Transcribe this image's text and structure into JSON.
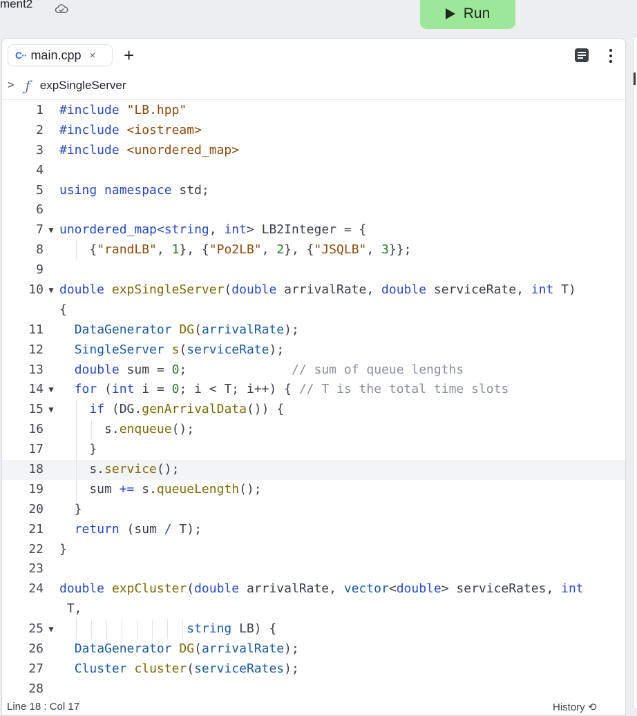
{
  "topbar": {
    "project_name": "ment2",
    "run_label": "Run"
  },
  "tabs": [
    {
      "label": "main.cpp",
      "icon": "cpp-icon",
      "close": "×"
    }
  ],
  "breadcrumb": {
    "func_symbol": "ƒ",
    "name": "expSingleServer"
  },
  "editor": {
    "lines": [
      {
        "n": "1",
        "fold": "",
        "guides": [],
        "t": [
          [
            "k",
            "#include "
          ],
          [
            "s",
            "\"LB.hpp\""
          ]
        ]
      },
      {
        "n": "2",
        "fold": "",
        "guides": [],
        "t": [
          [
            "k",
            "#include "
          ],
          [
            "s",
            "<iostream>"
          ]
        ]
      },
      {
        "n": "3",
        "fold": "",
        "guides": [],
        "t": [
          [
            "k",
            "#include "
          ],
          [
            "s",
            "<unordered_map>"
          ]
        ]
      },
      {
        "n": "4",
        "fold": "",
        "guides": [],
        "t": []
      },
      {
        "n": "5",
        "fold": "",
        "guides": [],
        "t": [
          [
            "k",
            "using namespace"
          ],
          [
            "p",
            " std;"
          ]
        ]
      },
      {
        "n": "6",
        "fold": "",
        "guides": [],
        "t": []
      },
      {
        "n": "7",
        "fold": "▼",
        "guides": [],
        "t": [
          [
            "k",
            "unordered_map<string"
          ],
          [
            "p",
            ", "
          ],
          [
            "k",
            "int"
          ],
          [
            "p",
            "> LB2Integer = {"
          ]
        ]
      },
      {
        "n": "8",
        "fold": "",
        "guides": [
          24
        ],
        "t": [
          [
            "p",
            "    {"
          ],
          [
            "s",
            "\"randLB\""
          ],
          [
            "p",
            ", "
          ],
          [
            "n",
            "1"
          ],
          [
            "p",
            "}, {"
          ],
          [
            "s",
            "\"Po2LB\""
          ],
          [
            "p",
            ", "
          ],
          [
            "n",
            "2"
          ],
          [
            "p",
            "}, {"
          ],
          [
            "s",
            "\"JSQLB\""
          ],
          [
            "p",
            ", "
          ],
          [
            "n",
            "3"
          ],
          [
            "p",
            "}};"
          ]
        ]
      },
      {
        "n": "9",
        "fold": "",
        "guides": [],
        "t": []
      },
      {
        "n": "10",
        "fold": "▼",
        "guides": [],
        "t": [
          [
            "k",
            "double "
          ],
          [
            "f",
            "expSingleServer"
          ],
          [
            "p",
            "("
          ],
          [
            "k",
            "double "
          ],
          [
            "p",
            "arrivalRate, "
          ],
          [
            "k",
            "double "
          ],
          [
            "p",
            "serviceRate, "
          ],
          [
            "k",
            "int "
          ],
          [
            "p",
            "T)"
          ]
        ]
      },
      {
        "n": "",
        "fold": "",
        "guides": [],
        "t": [
          [
            "p",
            "{"
          ]
        ]
      },
      {
        "n": "11",
        "fold": "",
        "guides": [],
        "t": [
          [
            "p",
            "  "
          ],
          [
            "v",
            "DataGenerator "
          ],
          [
            "f",
            "DG"
          ],
          [
            "p",
            "("
          ],
          [
            "v",
            "arrivalRate"
          ],
          [
            "p",
            ");"
          ]
        ]
      },
      {
        "n": "12",
        "fold": "",
        "guides": [],
        "t": [
          [
            "p",
            "  "
          ],
          [
            "v",
            "SingleServer "
          ],
          [
            "f",
            "s"
          ],
          [
            "p",
            "("
          ],
          [
            "v",
            "serviceRate"
          ],
          [
            "p",
            ");"
          ]
        ]
      },
      {
        "n": "13",
        "fold": "",
        "guides": [],
        "t": [
          [
            "p",
            "  "
          ],
          [
            "k",
            "double "
          ],
          [
            "p",
            "sum = "
          ],
          [
            "n",
            "0"
          ],
          [
            "p",
            ";              "
          ],
          [
            "c",
            "// sum of queue lengths"
          ]
        ]
      },
      {
        "n": "14",
        "fold": "▼",
        "guides": [],
        "t": [
          [
            "p",
            "  "
          ],
          [
            "k",
            "for "
          ],
          [
            "p",
            "("
          ],
          [
            "k",
            "int "
          ],
          [
            "p",
            "i = "
          ],
          [
            "n",
            "0"
          ],
          [
            "p",
            "; i < T; i++) { "
          ],
          [
            "c",
            "// T is the total time slots"
          ]
        ]
      },
      {
        "n": "15",
        "fold": "▼",
        "guides": [
          24
        ],
        "t": [
          [
            "p",
            "    "
          ],
          [
            "k",
            "if "
          ],
          [
            "p",
            "(DG."
          ],
          [
            "f",
            "genArrivalData"
          ],
          [
            "p",
            "()) {"
          ]
        ]
      },
      {
        "n": "16",
        "fold": "",
        "guides": [
          24,
          46
        ],
        "t": [
          [
            "p",
            "      s."
          ],
          [
            "f",
            "enqueue"
          ],
          [
            "p",
            "();"
          ]
        ]
      },
      {
        "n": "17",
        "fold": "",
        "guides": [
          24
        ],
        "t": [
          [
            "p",
            "    }"
          ]
        ]
      },
      {
        "n": "18",
        "fold": "",
        "guides": [
          24
        ],
        "active": true,
        "t": [
          [
            "p",
            "    s."
          ],
          [
            "f",
            "service"
          ],
          [
            "p",
            "();"
          ]
        ]
      },
      {
        "n": "19",
        "fold": "",
        "guides": [
          24
        ],
        "t": [
          [
            "p",
            "    sum "
          ],
          [
            "k",
            "+="
          ],
          [
            "p",
            " s."
          ],
          [
            "f",
            "queueLength"
          ],
          [
            "p",
            "();"
          ]
        ]
      },
      {
        "n": "20",
        "fold": "",
        "guides": [],
        "t": [
          [
            "p",
            "  }"
          ]
        ]
      },
      {
        "n": "21",
        "fold": "",
        "guides": [],
        "t": [
          [
            "p",
            "  "
          ],
          [
            "k",
            "return "
          ],
          [
            "p",
            "(sum "
          ],
          [
            "k",
            "/"
          ],
          [
            "p",
            " T);"
          ]
        ]
      },
      {
        "n": "22",
        "fold": "",
        "guides": [],
        "t": [
          [
            "p",
            "}"
          ]
        ]
      },
      {
        "n": "23",
        "fold": "",
        "guides": [],
        "t": []
      },
      {
        "n": "24",
        "fold": "",
        "guides": [],
        "t": [
          [
            "k",
            "double "
          ],
          [
            "f",
            "expCluster"
          ],
          [
            "p",
            "("
          ],
          [
            "k",
            "double "
          ],
          [
            "p",
            "arrivalRate, "
          ],
          [
            "v",
            "vector"
          ],
          [
            "p",
            "<"
          ],
          [
            "k",
            "double"
          ],
          [
            "p",
            "> serviceRates, "
          ],
          [
            "k",
            "int"
          ]
        ]
      },
      {
        "n": "",
        "fold": "",
        "guides": [],
        "t": [
          [
            "p",
            " T,"
          ]
        ]
      },
      {
        "n": "25",
        "fold": "▼",
        "guides": [
          24,
          46,
          68,
          90,
          112,
          134,
          156,
          178
        ],
        "t": [
          [
            "p",
            "                 "
          ],
          [
            "v",
            "string "
          ],
          [
            "p",
            "LB) {"
          ]
        ]
      },
      {
        "n": "26",
        "fold": "",
        "guides": [],
        "t": [
          [
            "p",
            "  "
          ],
          [
            "v",
            "DataGenerator "
          ],
          [
            "f",
            "DG"
          ],
          [
            "p",
            "("
          ],
          [
            "v",
            "arrivalRate"
          ],
          [
            "p",
            ");"
          ]
        ]
      },
      {
        "n": "27",
        "fold": "",
        "guides": [],
        "t": [
          [
            "p",
            "  "
          ],
          [
            "v",
            "Cluster "
          ],
          [
            "f",
            "cluster"
          ],
          [
            "p",
            "("
          ],
          [
            "v",
            "serviceRates"
          ],
          [
            "p",
            ");"
          ]
        ]
      },
      {
        "n": "28",
        "fold": "",
        "guides": [],
        "t": []
      }
    ]
  },
  "statusbar": {
    "position": "Line 18 : Col 17",
    "history_label": "History"
  }
}
